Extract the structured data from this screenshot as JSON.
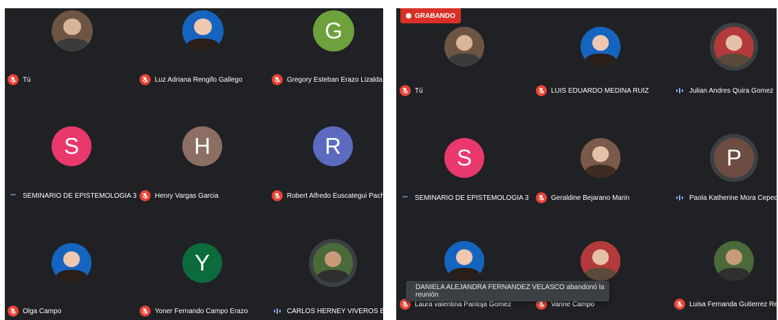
{
  "left": {
    "participants": [
      {
        "name": "Tú",
        "avatar_type": "photo",
        "status": "muted"
      },
      {
        "name": "Luz Adriana Rengifo Gallego",
        "avatar_type": "photo",
        "status": "muted"
      },
      {
        "name": "Gregory Esteban Erazo Lizalda",
        "avatar_type": "letter",
        "letter": "G",
        "color": "#6ea03c",
        "status": "muted"
      },
      {
        "name": "SEMINARIO DE EPISTEMOLOGIA 3",
        "avatar_type": "letter",
        "letter": "S",
        "color": "#e8386c",
        "status": "dots"
      },
      {
        "name": "Henry Vargas Garcia",
        "avatar_type": "letter",
        "letter": "H",
        "color": "#8d6e63",
        "status": "muted"
      },
      {
        "name": "Robert Alfredo Euscategui Pachon",
        "avatar_type": "letter",
        "letter": "R",
        "color": "#5c6bc0",
        "status": "muted"
      },
      {
        "name": "Olga Campo",
        "avatar_type": "photo",
        "status": "muted"
      },
      {
        "name": "Yoner Fernando Campo Erazo",
        "avatar_type": "letter",
        "letter": "Y",
        "color": "#0b6b3a",
        "status": "muted"
      },
      {
        "name": "CARLOS HERNEY VIVEROS BECERRA",
        "avatar_type": "photo",
        "status": "speaking"
      }
    ]
  },
  "right": {
    "recording_label": "GRABANDO",
    "participants": [
      {
        "name": "Tú",
        "avatar_type": "photo",
        "status": "muted"
      },
      {
        "name": "LUIS EDUARDO MEDINA RUIZ",
        "avatar_type": "photo",
        "status": "muted"
      },
      {
        "name": "Julian Andres Quira Gomez",
        "avatar_type": "photo",
        "status": "speaking"
      },
      {
        "name": "SEMINARIO DE EPISTEMOLOGIA 3",
        "avatar_type": "letter",
        "letter": "S",
        "color": "#e8386c",
        "status": "dots"
      },
      {
        "name": "Geraldine Bejarano Marin",
        "avatar_type": "photo",
        "status": "muted"
      },
      {
        "name": "Paola Katherine Mora Cepeda",
        "avatar_type": "letter",
        "letter": "P",
        "color": "#6d4c41",
        "status": "speaking"
      },
      {
        "name": "Laura valentina Pantoja Gomez",
        "avatar_type": "photo",
        "status": "muted"
      },
      {
        "name": "Vanne Campo",
        "avatar_type": "photo",
        "status": "muted"
      },
      {
        "name": "Luisa Fernanda Gutierrez Rengifo",
        "avatar_type": "photo",
        "status": "muted"
      }
    ],
    "notification": "DANIELA ALEJANDRA FERNANDEZ VELASCO abandonó la reunión"
  },
  "icons": {
    "muted": "mic-off-icon",
    "speaking": "audio-level-icon",
    "dots": "more-dots-icon",
    "recording": "record-dot-icon"
  },
  "colors": {
    "tile_background": "#202124",
    "mic_off": "#ea4335",
    "recording": "#d93025",
    "audio_indicator": "#8ab4f8"
  }
}
